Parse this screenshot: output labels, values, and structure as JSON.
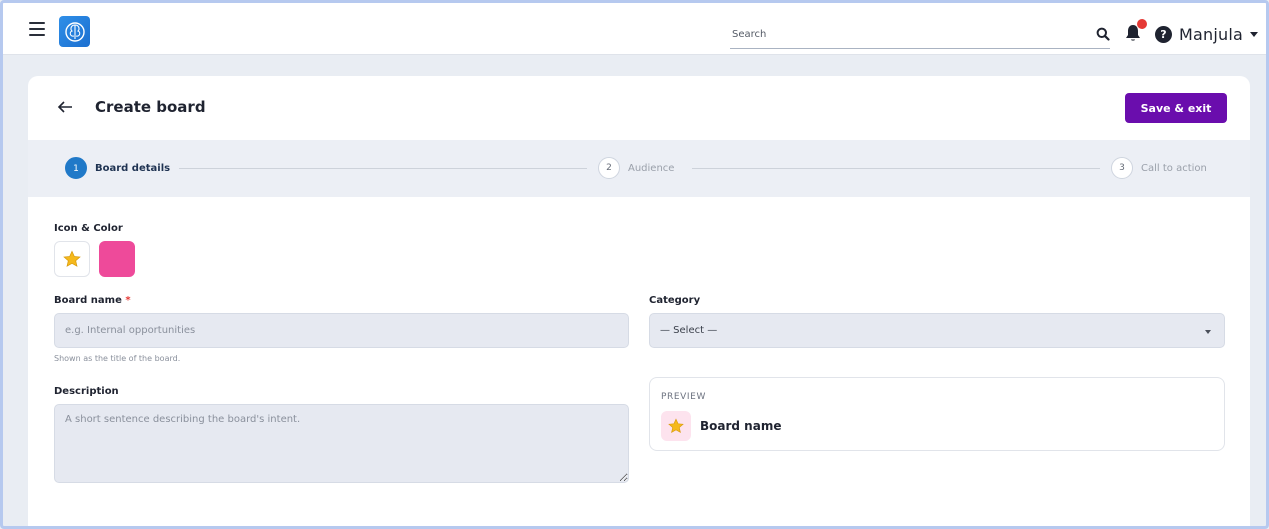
{
  "header": {
    "search_placeholder": "Search",
    "user_name": "Manjula"
  },
  "page": {
    "title": "Create board",
    "save_label": "Save & exit"
  },
  "steps": [
    {
      "number": "1",
      "label": "Board details",
      "active": true
    },
    {
      "number": "2",
      "label": "Audience",
      "active": false
    },
    {
      "number": "3",
      "label": "Call to action",
      "active": false
    }
  ],
  "form": {
    "icon_color_label": "Icon & Color",
    "icon": "star-icon",
    "color": "#ee4a9a",
    "board_name_label": "Board name",
    "required_mark": "*",
    "board_name_placeholder": "e.g. Internal opportunities",
    "board_name_value": "",
    "board_name_helper": "Shown as the title of the board.",
    "category_label": "Category",
    "category_value": "— Select —",
    "description_label": "Description",
    "description_placeholder": "A short sentence describing the board's intent.",
    "description_value": ""
  },
  "preview": {
    "label": "PREVIEW",
    "name": "Board name"
  },
  "colors": {
    "primary": "#6a0dad",
    "step_active": "#2079c8",
    "notification": "#e53935"
  }
}
